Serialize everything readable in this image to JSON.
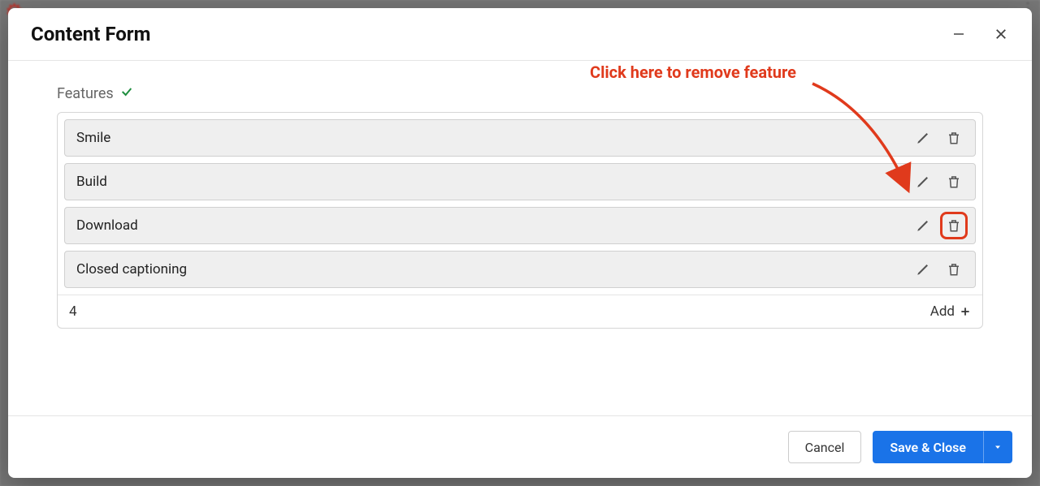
{
  "modal": {
    "title": "Content Form",
    "section_label": "Features",
    "features": [
      {
        "label": "Smile"
      },
      {
        "label": "Build"
      },
      {
        "label": "Download"
      },
      {
        "label": "Closed captioning"
      }
    ],
    "count": "4",
    "add_label": "Add"
  },
  "annotation": {
    "text": "Click here to remove feature"
  },
  "footer": {
    "cancel": "Cancel",
    "save": "Save & Close"
  }
}
